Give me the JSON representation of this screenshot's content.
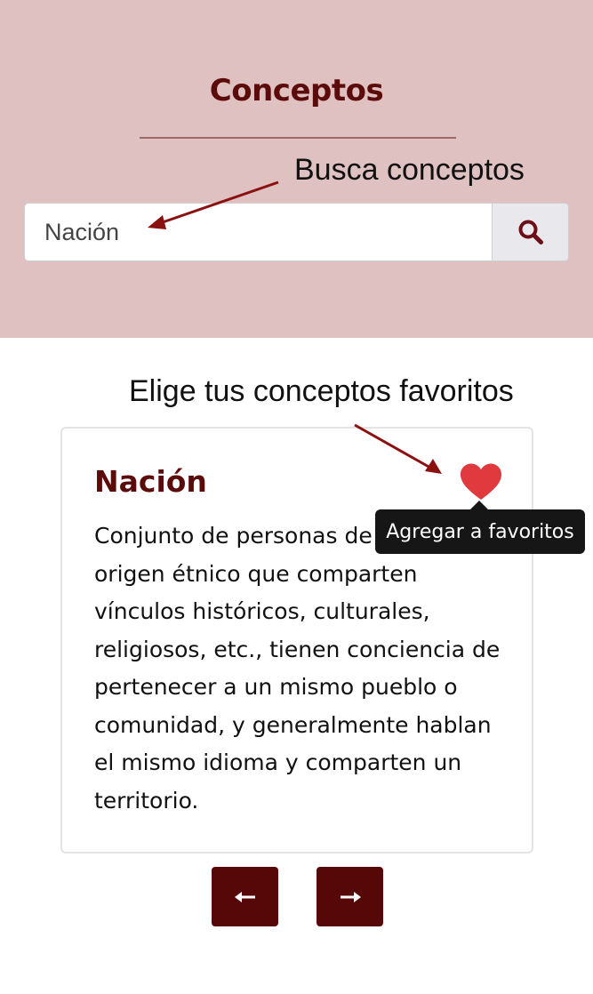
{
  "header": {
    "title": "Conceptos",
    "background_color": "#dfc1c1",
    "title_color": "#5c0b0b"
  },
  "annotations": {
    "search_hint": "Busca conceptos",
    "favorites_hint": "Elige tus conceptos favoritos",
    "arrow_color": "#8b1010"
  },
  "search": {
    "value": "Nación",
    "icon": "search-icon"
  },
  "concept_card": {
    "title": "Nación",
    "definition": "Conjunto de personas de un mismo origen étnico que comparten vínculos históricos, culturales, religiosos, etc., tienen conciencia de pertenecer a un mismo pueblo o comunidad, y generalmente hablan el mismo idioma y comparten un territorio.",
    "favorite_icon": "heart-icon",
    "heart_color": "#e0393e"
  },
  "tooltip": {
    "text": "Agregar a favoritos"
  },
  "pagination": {
    "prev_icon": "arrow-left-icon",
    "next_icon": "arrow-right-icon",
    "button_color": "#560808"
  }
}
